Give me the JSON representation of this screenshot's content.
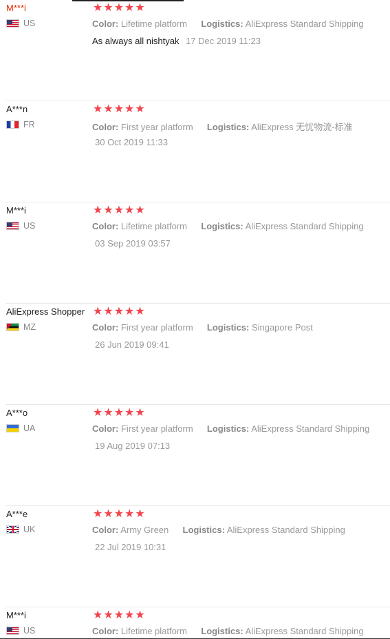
{
  "reviews": [
    {
      "user": "M***i",
      "country_code": "US",
      "flag_icon": "us-flag-icon",
      "rating": 5,
      "color_label": "Color:",
      "color_value": "Lifetime platform",
      "logistics_label": "Logistics:",
      "logistics_value": "AliExpress Standard Shipping",
      "text": "As always all nishtyak",
      "date": "17 Dec 2019 11:23"
    },
    {
      "user": "A***n",
      "country_code": "FR",
      "flag_icon": "fr-flag-icon",
      "rating": 5,
      "color_label": "Color:",
      "color_value": "First year platform",
      "logistics_label": "Logistics:",
      "logistics_value": "AliExpress 无忧物流-标准",
      "date": "30 Oct 2019 11:33"
    },
    {
      "user": "M***i",
      "country_code": "US",
      "flag_icon": "us-flag-icon",
      "rating": 5,
      "color_label": "Color:",
      "color_value": "Lifetime platform",
      "logistics_label": "Logistics:",
      "logistics_value": "AliExpress Standard Shipping",
      "date": "03 Sep 2019 03:57"
    },
    {
      "user": "AliExpress Shopper",
      "country_code": "MZ",
      "flag_icon": "mz-flag-icon",
      "rating": 5,
      "color_label": "Color:",
      "color_value": "First year platform",
      "logistics_label": "Logistics:",
      "logistics_value": "Singapore Post",
      "date": "26 Jun 2019 09:41"
    },
    {
      "user": "A***o",
      "country_code": "UA",
      "flag_icon": "ua-flag-icon",
      "rating": 5,
      "color_label": "Color:",
      "color_value": "First year platform",
      "logistics_label": "Logistics:",
      "logistics_value": "AliExpress Standard Shipping",
      "date": "19 Aug 2019 07:13"
    },
    {
      "user": "A***e",
      "country_code": "UK",
      "flag_icon": "uk-flag-icon",
      "rating": 5,
      "color_label": "Color:",
      "color_value": "Army Green",
      "logistics_label": "Logistics:",
      "logistics_value": "AliExpress Standard Shipping",
      "date": "22 Jul 2019 10:31"
    },
    {
      "user": "M***i",
      "country_code": "US",
      "flag_icon": "us-flag-icon",
      "rating": 5,
      "color_label": "Color:",
      "color_value": "Lifetime platform",
      "logistics_label": "Logistics:",
      "logistics_value": "AliExpress Standard Shipping"
    }
  ],
  "colors": {
    "star": "#f2444c",
    "first_user": "#e62e04",
    "divider": "#e8e8e8"
  }
}
